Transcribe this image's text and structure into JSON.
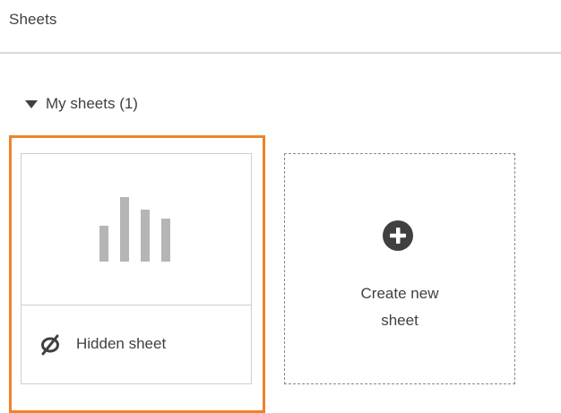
{
  "header": {
    "title": "Sheets"
  },
  "section": {
    "label": "My sheets (1)",
    "toggle_icon": "caret-down-icon"
  },
  "sheets": [
    {
      "thumbnail_icon": "bar-chart-icon",
      "status_icon": "eye-slash-icon",
      "status_label": "Hidden sheet",
      "selected": true
    }
  ],
  "create": {
    "icon": "plus-circle-icon",
    "label": "Create new\nsheet"
  },
  "colors": {
    "selection": "#f0822a",
    "text": "#404040",
    "thumbnail_bars": "#b5b5b5",
    "divider": "#d9d9d9"
  }
}
